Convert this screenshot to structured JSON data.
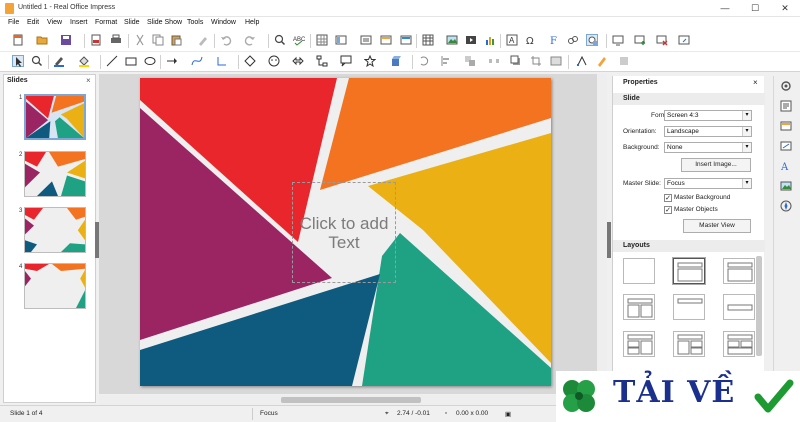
{
  "window": {
    "title": "Untitled 1 - Real Office Impress",
    "minimize": "—",
    "maximize": "☐",
    "close": "✕"
  },
  "menu": [
    "File",
    "Edit",
    "View",
    "Insert",
    "Format",
    "Slide",
    "Slide Show",
    "Tools",
    "Window",
    "Help"
  ],
  "slides_panel": {
    "title": "Slides",
    "close": "×",
    "numbers": [
      "1",
      "2",
      "3",
      "4"
    ]
  },
  "slide": {
    "placeholder": "Click to add Text"
  },
  "properties": {
    "title": "Properties",
    "section_slide": "Slide",
    "format_label": "Format:",
    "format_value": "Screen 4:3",
    "orientation_label": "Orientation:",
    "orientation_value": "Landscape",
    "background_label": "Background:",
    "background_value": "None",
    "insert_image": "Insert Image...",
    "master_slide_label": "Master Slide:",
    "master_slide_value": "Focus",
    "master_background": "Master Background",
    "master_objects": "Master Objects",
    "master_view": "Master View",
    "section_layouts": "Layouts"
  },
  "status": {
    "slide_count": "Slide 1 of 4",
    "master": "Focus",
    "position": "2.74 / -0.01",
    "size": "0.00 x 0.00"
  },
  "watermark": {
    "text": "TẢI VỀ"
  },
  "colors": {
    "red": "#e8262c",
    "orange": "#f37321",
    "yellow": "#ebb013",
    "teal": "#1fa184",
    "blue": "#0f5a7f",
    "purple": "#9b2463"
  }
}
